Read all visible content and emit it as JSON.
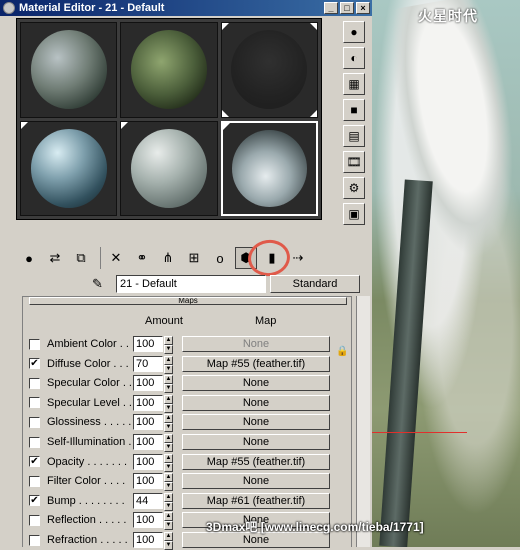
{
  "window": {
    "title": "Material Editor - 21 - Default"
  },
  "scene": {
    "logo_text": "火星时代"
  },
  "toolbar_right": [
    "sample-type-icon",
    "backlight-icon",
    "background-icon",
    "uv-tiling-icon",
    "video-color-check-icon",
    "make-preview-icon",
    "options-icon",
    "select-by-material-icon",
    "material-navigator-icon"
  ],
  "toolbar_bottom": [
    "get-material-icon",
    "put-to-scene-icon",
    "assign-to-selection-icon",
    "reset-map-icon",
    "make-unique-icon",
    "put-to-library-icon",
    "material-effects-channel-icon",
    "show-map-in-viewport-icon",
    "show-end-result-icon",
    "go-to-parent-icon",
    "go-forward-to-sibling-icon"
  ],
  "material": {
    "name": "21 - Default",
    "type": "Standard"
  },
  "maps": {
    "title": "Maps",
    "header_amount": "Amount",
    "header_map": "Map",
    "rows": [
      {
        "label": "Ambient Color . . .",
        "checked": false,
        "amount": "100",
        "map": "None",
        "disabled": true
      },
      {
        "label": "Diffuse Color . . .",
        "checked": true,
        "amount": "70",
        "map": "Map #55 (feather.tif)"
      },
      {
        "label": "Specular Color . .",
        "checked": false,
        "amount": "100",
        "map": "None"
      },
      {
        "label": "Specular Level . .",
        "checked": false,
        "amount": "100",
        "map": "None"
      },
      {
        "label": "Glossiness . . . . .",
        "checked": false,
        "amount": "100",
        "map": "None"
      },
      {
        "label": "Self-Illumination .",
        "checked": false,
        "amount": "100",
        "map": "None"
      },
      {
        "label": "Opacity . . . . . . .",
        "checked": true,
        "amount": "100",
        "map": "Map #55 (feather.tif)"
      },
      {
        "label": "Filter Color . . . .",
        "checked": false,
        "amount": "100",
        "map": "None"
      },
      {
        "label": "Bump . . . . . . . .",
        "checked": true,
        "amount": "44",
        "map": "Map #61 (feather.tif)"
      },
      {
        "label": "Reflection . . . . .",
        "checked": false,
        "amount": "100",
        "map": "None"
      },
      {
        "label": "Refraction . . . . .",
        "checked": false,
        "amount": "100",
        "map": "None"
      }
    ]
  },
  "watermark": "3Dmax吧 [www.linecg.com/tieba/1771]"
}
